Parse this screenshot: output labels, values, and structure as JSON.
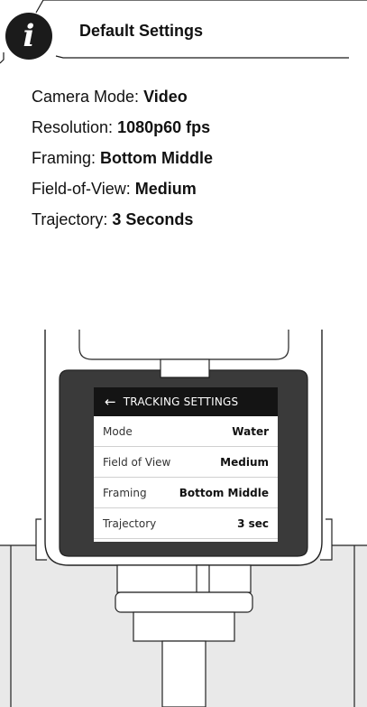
{
  "header": {
    "icon": "info-icon",
    "icon_glyph": "i",
    "title": "Default Settings"
  },
  "settings": [
    {
      "label": "Camera Mode: ",
      "value": "Video"
    },
    {
      "label": "Resolution: ",
      "value": "1080p60 fps"
    },
    {
      "label": "Framing: ",
      "value": "Bottom Middle"
    },
    {
      "label": "Field-of-View: ",
      "value": "Medium"
    },
    {
      "label": "Trajectory: ",
      "value": "3 Seconds"
    }
  ],
  "device_screen": {
    "back_icon": "←",
    "title": "TRACKING SETTINGS",
    "rows": [
      {
        "label": "Mode",
        "value": "Water"
      },
      {
        "label": "Field of View",
        "value": "Medium"
      },
      {
        "label": "Framing",
        "value": "Bottom Middle"
      },
      {
        "label": "Trajectory",
        "value": "3 sec"
      }
    ]
  },
  "colors": {
    "badge": "#1b1b1b",
    "screen_header": "#141414",
    "device_body": "#3a3a3a",
    "background_panel": "#e8e8e8"
  }
}
